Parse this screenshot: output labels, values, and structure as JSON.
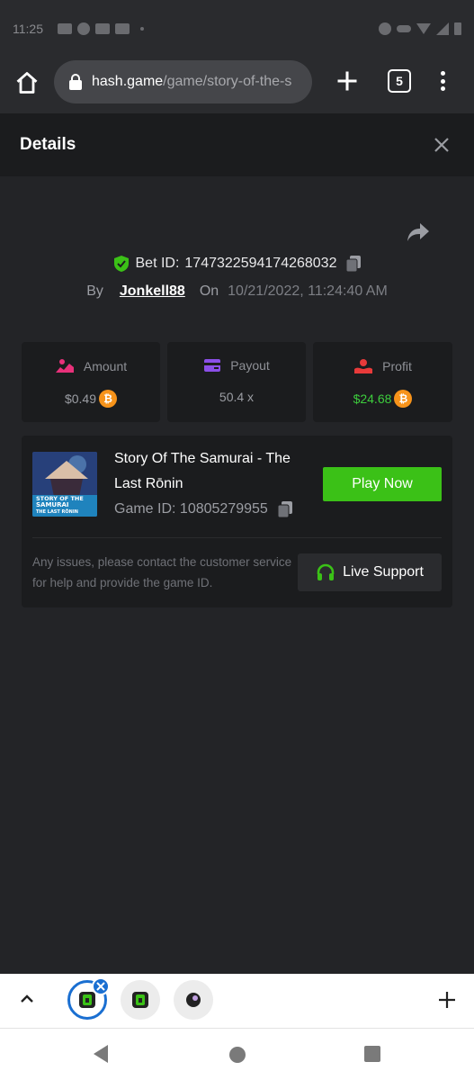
{
  "status_bar": {
    "time": "11:25"
  },
  "browser": {
    "url_domain": "hash.game",
    "url_path": "/game/story-of-the-s",
    "tab_count": "5"
  },
  "details": {
    "title": "Details",
    "bet_id_label": "Bet ID:",
    "bet_id": "1747322594174268032",
    "by_label": "By",
    "username": "Jonkell88",
    "on_label": "On",
    "date": "10/21/2022, 11:24:40 AM"
  },
  "stats": [
    {
      "label": "Amount",
      "value": "$0.49",
      "coin": true,
      "color": "#9b9da3"
    },
    {
      "label": "Payout",
      "value": "50.4 x",
      "coin": false,
      "color": "#9b9da3"
    },
    {
      "label": "Profit",
      "value": "$24.68",
      "coin": true,
      "color": "#3dcc3d"
    }
  ],
  "game": {
    "name": "Story Of The Samurai - The Last Rōnin",
    "game_id_label": "Game ID:",
    "game_id": "10805279955",
    "play_label": "Play Now",
    "thumb_text_1": "STORY OF THE",
    "thumb_text_2": "SAMURAI",
    "thumb_text_3": "THE LAST RŌNIN",
    "issue_text": "Any issues, please contact the customer service for help and provide the game ID.",
    "support_label": "Live Support"
  },
  "colors": {
    "accent_green": "#3bc117",
    "profit_green": "#3dcc3d",
    "coin_orange": "#f7931a",
    "tab_blue": "#1a6fd1"
  }
}
